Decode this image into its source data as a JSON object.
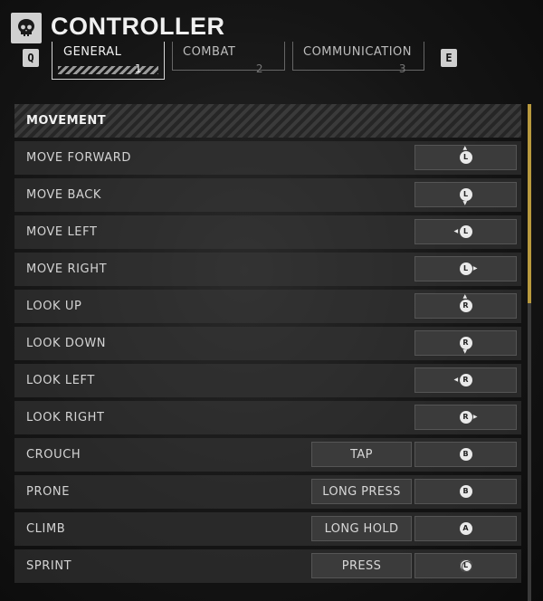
{
  "header": {
    "title": "CONTROLLER",
    "logo_icon": "skull-icon",
    "prev_key": "Q",
    "next_key": "E"
  },
  "tabs": [
    {
      "label": "GENERAL",
      "num": "1",
      "active": true
    },
    {
      "label": "COMBAT",
      "num": "2",
      "active": false
    },
    {
      "label": "COMMUNICATION",
      "num": "3",
      "active": false
    }
  ],
  "section": {
    "title": "MOVEMENT"
  },
  "rows": [
    {
      "label": "MOVE FORWARD",
      "mode": "",
      "glyph": "L",
      "dir": "up"
    },
    {
      "label": "MOVE BACK",
      "mode": "",
      "glyph": "L",
      "dir": "down"
    },
    {
      "label": "MOVE LEFT",
      "mode": "",
      "glyph": "L",
      "dir": "left"
    },
    {
      "label": "MOVE RIGHT",
      "mode": "",
      "glyph": "L",
      "dir": "right"
    },
    {
      "label": "LOOK UP",
      "mode": "",
      "glyph": "R",
      "dir": "up"
    },
    {
      "label": "LOOK DOWN",
      "mode": "",
      "glyph": "R",
      "dir": "down"
    },
    {
      "label": "LOOK LEFT",
      "mode": "",
      "glyph": "R",
      "dir": "left"
    },
    {
      "label": "LOOK RIGHT",
      "mode": "",
      "glyph": "R",
      "dir": "right"
    },
    {
      "label": "CROUCH",
      "mode": "TAP",
      "glyph": "B",
      "dir": ""
    },
    {
      "label": "PRONE",
      "mode": "LONG PRESS",
      "glyph": "B",
      "dir": ""
    },
    {
      "label": "CLIMB",
      "mode": "LONG HOLD",
      "glyph": "A",
      "dir": ""
    },
    {
      "label": "SPRINT",
      "mode": "PRESS",
      "glyph": "L",
      "dir": "",
      "ring": true
    }
  ],
  "scroll": {
    "position": 0.0,
    "visible_fraction": 0.4
  },
  "colors": {
    "accent": "#b99a3e",
    "row_bg": "#3a3a3a"
  }
}
